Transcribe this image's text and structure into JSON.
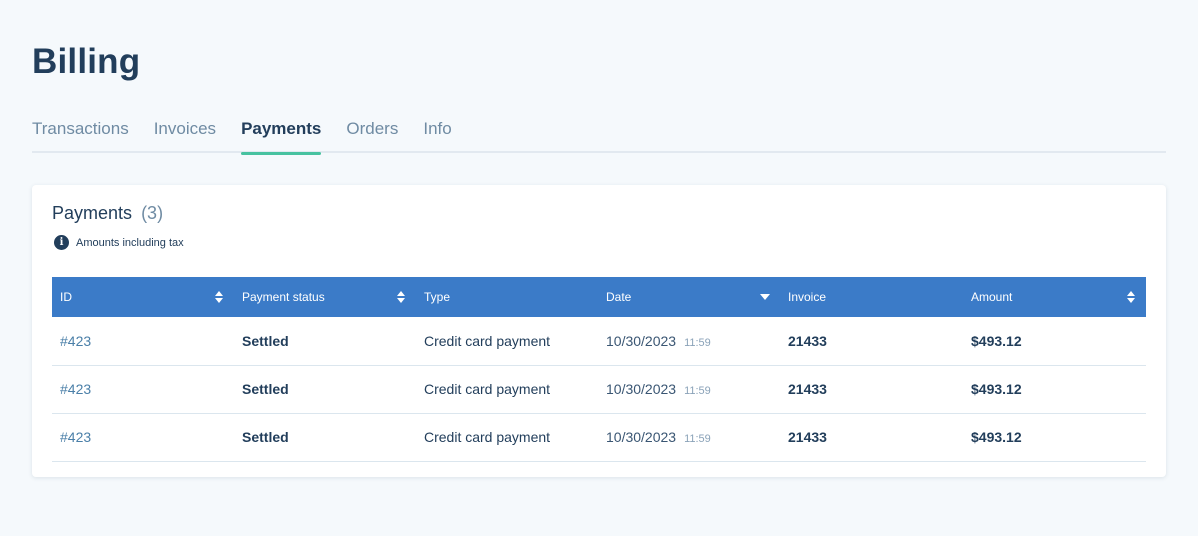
{
  "page": {
    "title": "Billing"
  },
  "tabs": [
    {
      "label": "Transactions",
      "active": false
    },
    {
      "label": "Invoices",
      "active": false
    },
    {
      "label": "Payments",
      "active": true
    },
    {
      "label": "Orders",
      "active": false
    },
    {
      "label": "Info",
      "active": false
    }
  ],
  "card": {
    "title": "Payments",
    "count": "(3)",
    "note": "Amounts including tax",
    "note_icon": "info-icon"
  },
  "table": {
    "header_color": "#3b7bc8",
    "columns": [
      {
        "label": "ID",
        "sort": "both"
      },
      {
        "label": "Payment status",
        "sort": "both"
      },
      {
        "label": "Type",
        "sort": "none"
      },
      {
        "label": "Date",
        "sort": "desc"
      },
      {
        "label": "Invoice",
        "sort": "none"
      },
      {
        "label": "Amount",
        "sort": "both"
      }
    ],
    "rows": [
      {
        "id": "#423",
        "status": "Settled",
        "type": "Credit card payment",
        "date": "10/30/2023",
        "time": "11:59",
        "invoice": "21433",
        "amount": "$493.12"
      },
      {
        "id": "#423",
        "status": "Settled",
        "type": "Credit card payment",
        "date": "10/30/2023",
        "time": "11:59",
        "invoice": "21433",
        "amount": "$493.12"
      },
      {
        "id": "#423",
        "status": "Settled",
        "type": "Credit card payment",
        "date": "10/30/2023",
        "time": "11:59",
        "invoice": "21433",
        "amount": "$493.12"
      }
    ]
  },
  "colors": {
    "accent": "#47c2a0",
    "text": "#223e5b",
    "muted": "#6f8ba3",
    "background": "#f5f9fc"
  }
}
